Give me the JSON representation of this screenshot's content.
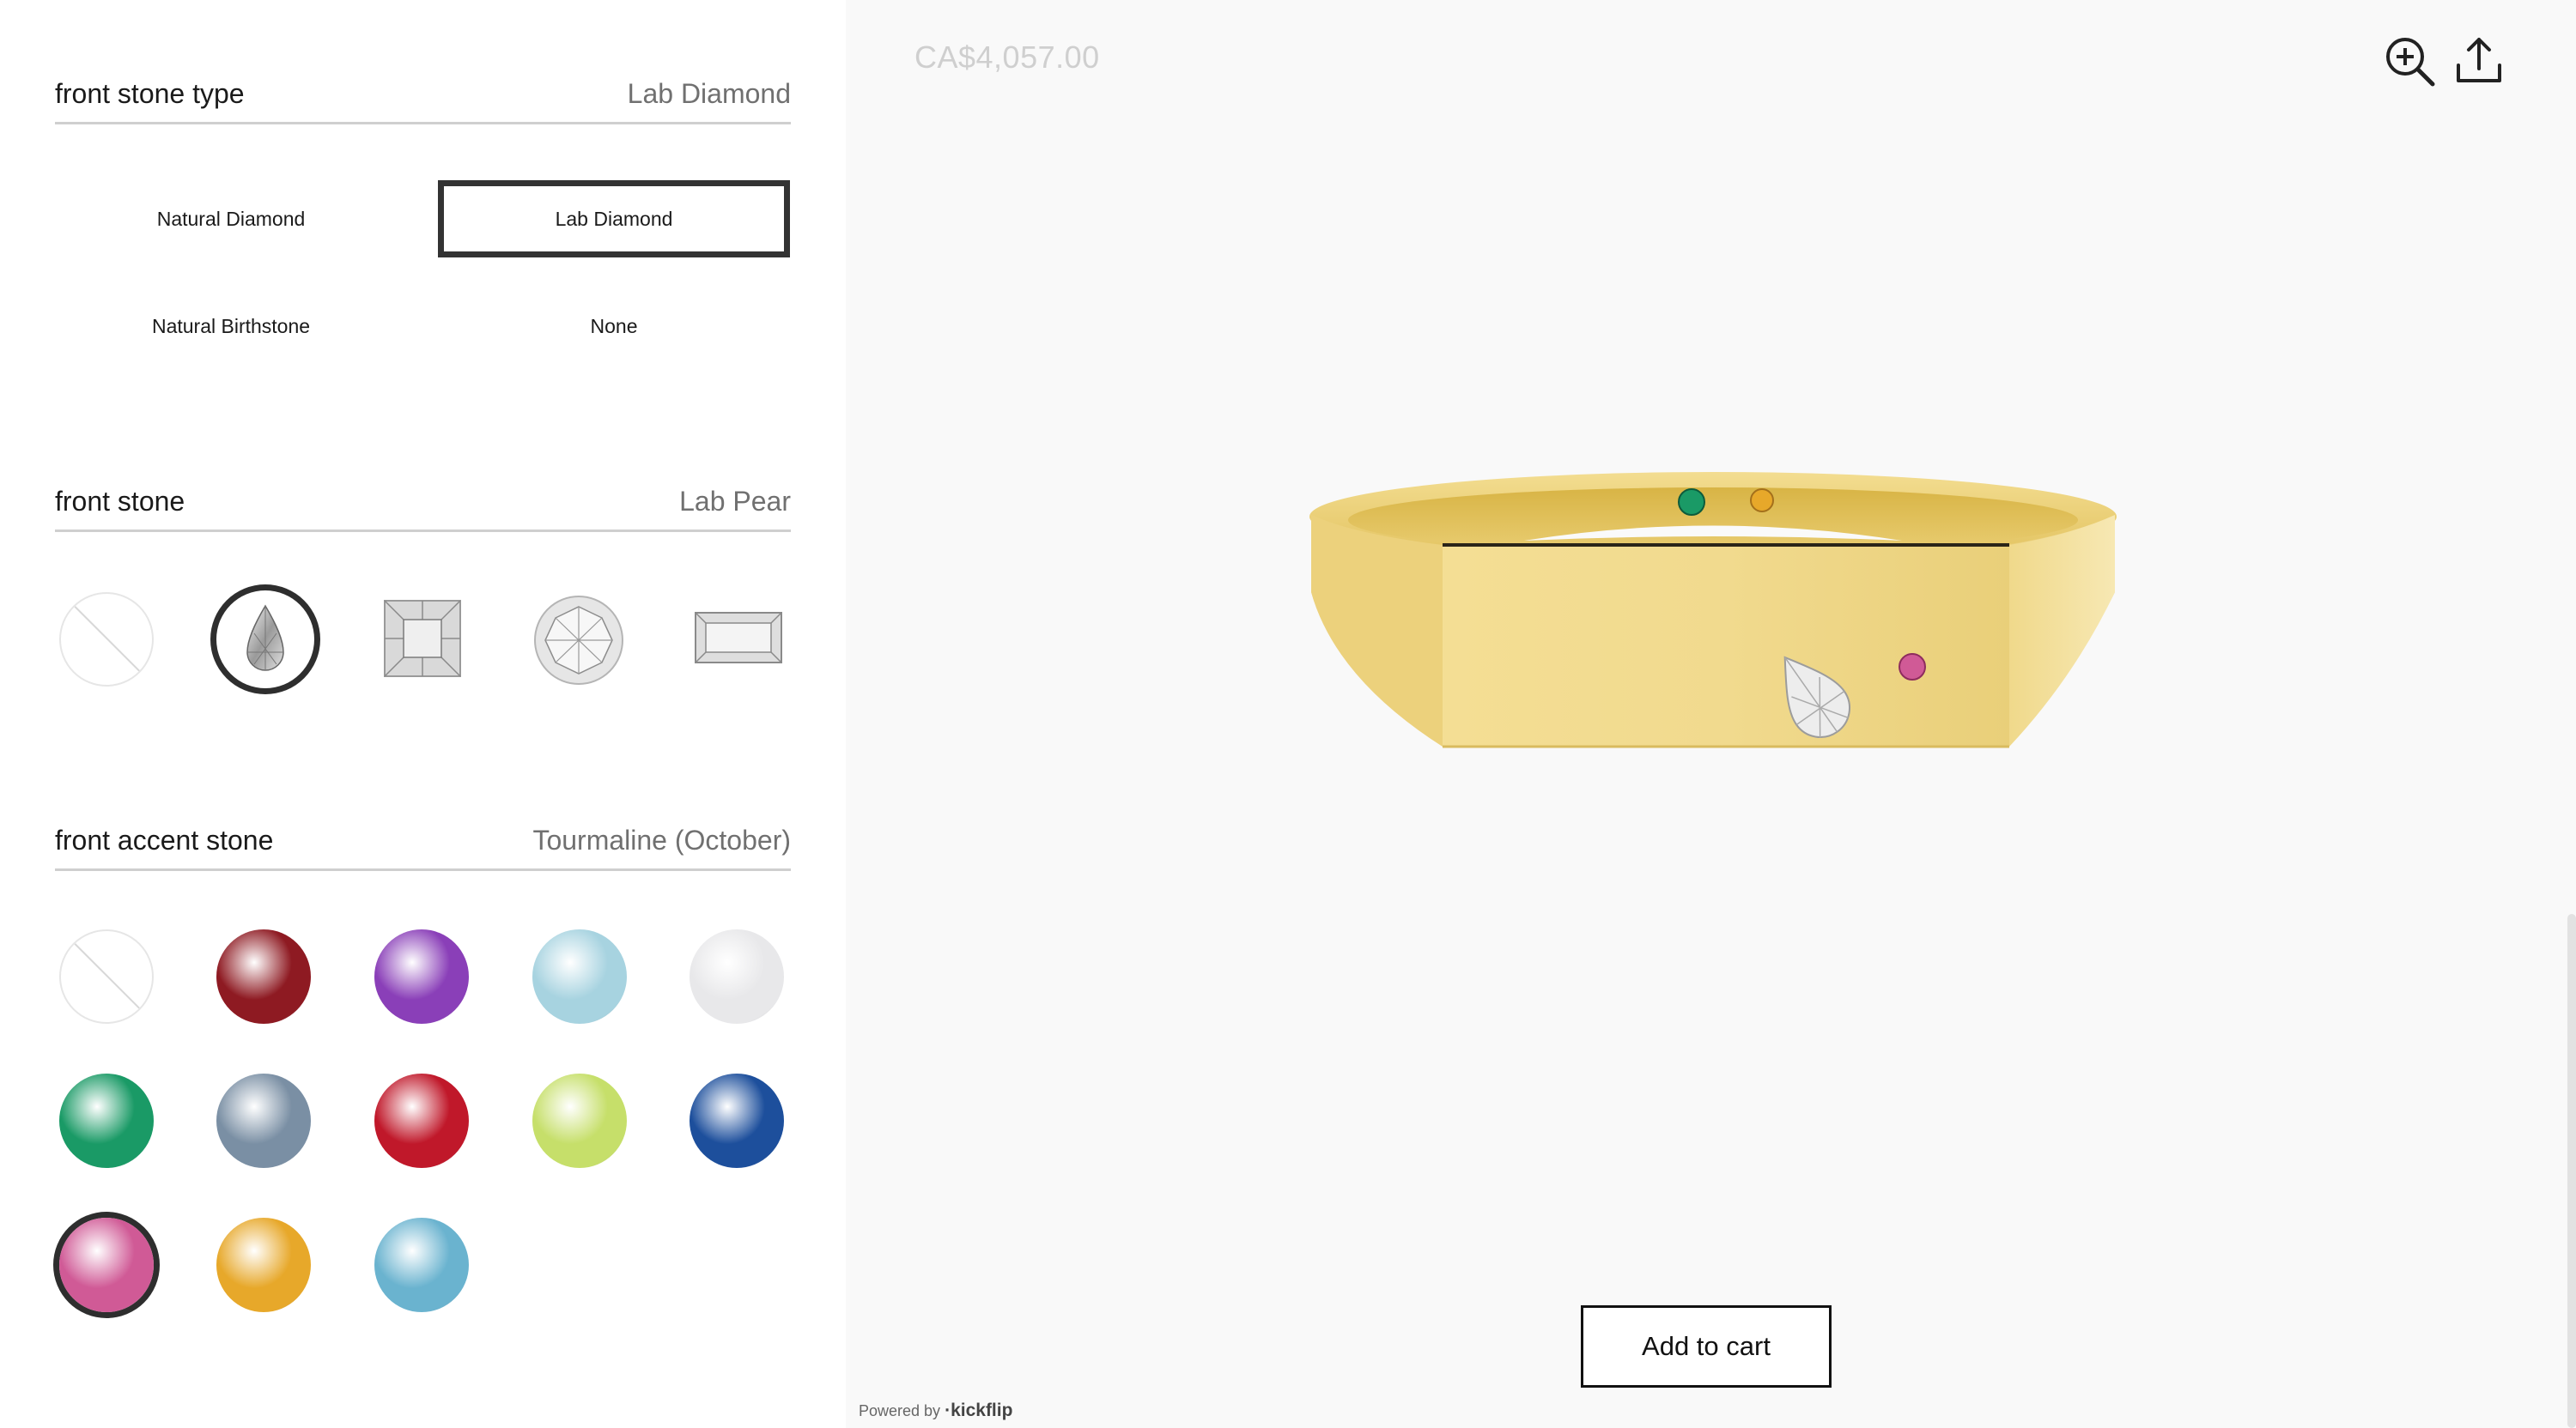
{
  "stone_type": {
    "title": "front stone type",
    "selected": "Lab Diamond",
    "options": [
      "Natural Diamond",
      "Lab Diamond",
      "Natural Birthstone",
      "None"
    ]
  },
  "front_stone": {
    "title": "front stone",
    "selected": "Lab Pear",
    "shapes": [
      "none-icon",
      "pear-cut-icon",
      "princess-cut-icon",
      "round-cut-icon",
      "baguette-cut-icon"
    ]
  },
  "accent_stone": {
    "title": "front accent stone",
    "selected": "Tourmaline (October)",
    "colors": [
      "none",
      "#8e1a22",
      "#8a3fb8",
      "#a7d3e0",
      "#e8e8ea",
      "#1a9a66",
      "#7a8fa4",
      "#c0182a",
      "#c6df6a",
      "#1d4f9c",
      "#d05a96",
      "#e7a82a",
      "#6ab3cf"
    ]
  },
  "preview": {
    "price": "CA$4,057.00",
    "add_to_cart": "Add to cart",
    "powered_by": "Powered by",
    "brand": "·kickflip"
  }
}
